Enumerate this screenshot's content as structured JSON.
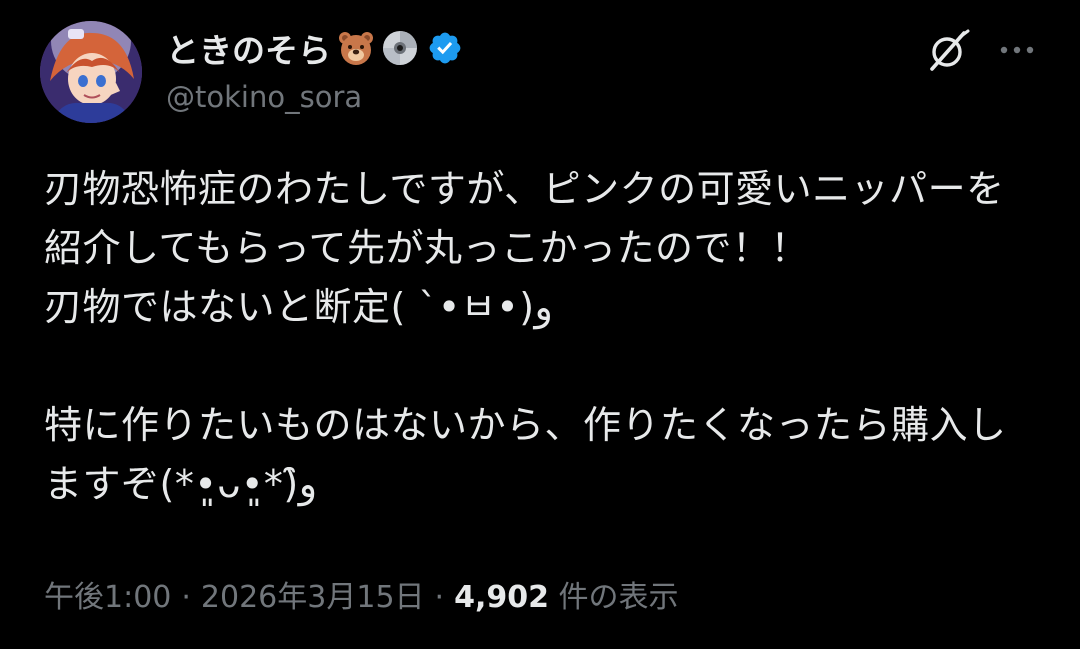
{
  "user": {
    "display_name": "ときのそら",
    "handle": "@tokino_sora",
    "name_emojis": [
      "bear-face-emoji",
      "dvd-disc-emoji"
    ],
    "verified_icon": "verified-badge-icon",
    "verified_color": "#1d9bf0"
  },
  "header_actions": {
    "grok_icon": "grok-icon",
    "more_icon": "more-options-icon"
  },
  "tweet": {
    "text": "刃物恐怖症のわたしですが、ピンクの可愛いニッパーを紹介してもらって先が丸っこかったので！！\n刃物ではないと断定( ˋ•ㅂ•)و\n\n特に作りたいものはないから、作りたくなったら購入しますぞ(*•͈ᴗ•͈*)و̑̑"
  },
  "meta": {
    "time": "午後1:00",
    "separator": "·",
    "date": "2026年3月15日",
    "views_count": "4,902",
    "views_label": "件の表示"
  },
  "colors": {
    "background": "#000000",
    "primary_text": "#e7e9ea",
    "secondary_text": "#71767b"
  }
}
